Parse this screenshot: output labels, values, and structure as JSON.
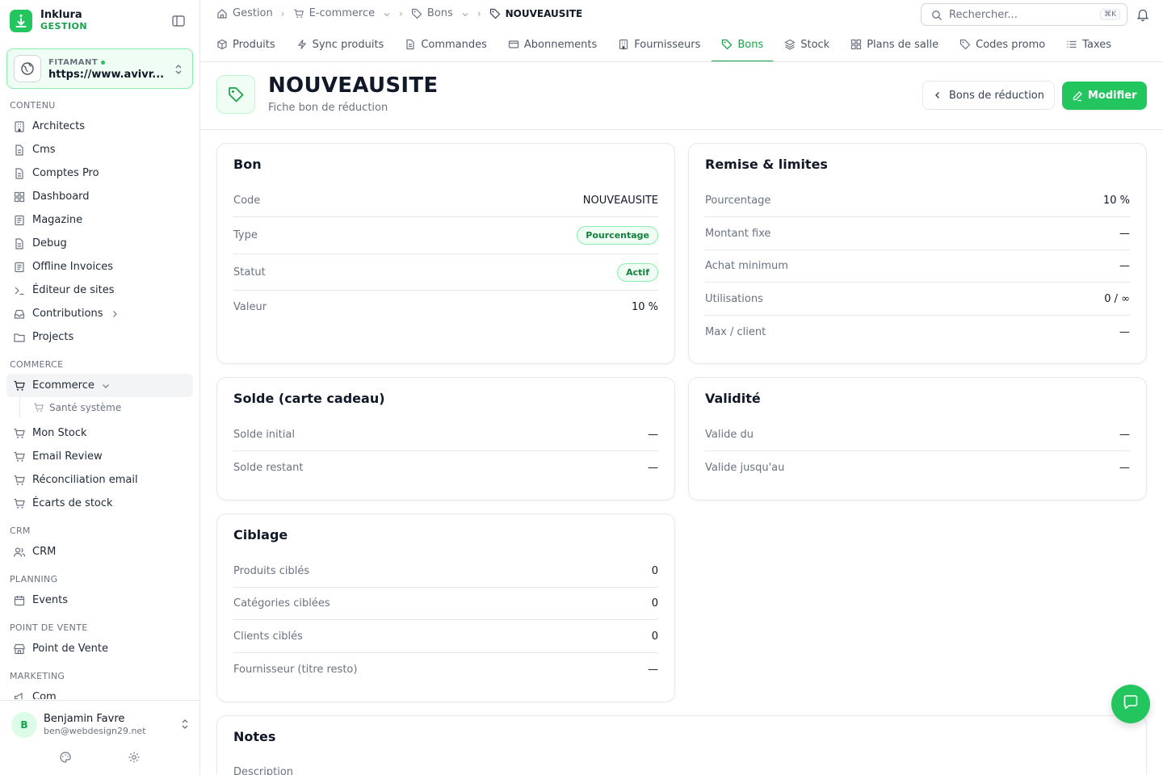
{
  "brand": {
    "name": "Inklura",
    "sub": "GESTION"
  },
  "site": {
    "label": "FITAMANT",
    "url": "https://www.avivr..."
  },
  "nav": {
    "contenu": {
      "title": "CONTENU",
      "items": [
        "Architects",
        "Cms",
        "Comptes Pro",
        "Dashboard",
        "Magazine",
        "Debug",
        "Offline Invoices",
        "Éditeur de sites",
        "Contributions",
        "Projects"
      ]
    },
    "commerce": {
      "title": "COMMERCE",
      "active": "Ecommerce",
      "sub": "Santé système",
      "items": [
        "Mon Stock",
        "Email Review",
        "Réconciliation email",
        "Écarts de stock"
      ]
    },
    "crm": {
      "title": "CRM",
      "items": [
        "CRM"
      ]
    },
    "planning": {
      "title": "PLANNING",
      "items": [
        "Events"
      ]
    },
    "pdv": {
      "title": "POINT DE VENTE",
      "items": [
        "Point de Vente"
      ]
    },
    "marketing": {
      "title": "MARKETING",
      "items": [
        "Com"
      ]
    }
  },
  "user": {
    "initial": "B",
    "name": "Benjamin Favre",
    "email": "ben@webdesign29.net"
  },
  "breadcrumb": [
    "Gestion",
    "E-commerce",
    "Bons",
    "NOUVEAUSITE"
  ],
  "search": {
    "placeholder": "Rechercher...",
    "shortcut": "⌘K"
  },
  "tabs": [
    "Produits",
    "Sync produits",
    "Commandes",
    "Abonnements",
    "Fournisseurs",
    "Bons",
    "Stock",
    "Plans de salle",
    "Codes promo",
    "Taxes"
  ],
  "active_tab": "Bons",
  "header": {
    "title": "NOUVEAUSITE",
    "subtitle": "Fiche bon de réduction",
    "back_label": "Bons de réduction",
    "edit_label": "Modifier"
  },
  "bon": {
    "title": "Bon",
    "code_label": "Code",
    "code": "NOUVEAUSITE",
    "type_label": "Type",
    "type": "Pourcentage",
    "status_label": "Statut",
    "status": "Actif",
    "value_label": "Valeur",
    "value": "10 %"
  },
  "remise": {
    "title": "Remise & limites",
    "rows": [
      {
        "label": "Pourcentage",
        "value": "10 %"
      },
      {
        "label": "Montant fixe",
        "value": "—"
      },
      {
        "label": "Achat minimum",
        "value": "—"
      },
      {
        "label": "Utilisations",
        "value": "0 / ∞"
      },
      {
        "label": "Max / client",
        "value": "—"
      }
    ]
  },
  "solde": {
    "title": "Solde (carte cadeau)",
    "rows": [
      {
        "label": "Solde initial",
        "value": "—"
      },
      {
        "label": "Solde restant",
        "value": "—"
      }
    ]
  },
  "validite": {
    "title": "Validité",
    "rows": [
      {
        "label": "Valide du",
        "value": "—"
      },
      {
        "label": "Valide jusqu'au",
        "value": "—"
      }
    ]
  },
  "ciblage": {
    "title": "Ciblage",
    "rows": [
      {
        "label": "Produits ciblés",
        "value": "0"
      },
      {
        "label": "Catégories ciblées",
        "value": "0"
      },
      {
        "label": "Clients ciblés",
        "value": "0"
      },
      {
        "label": "Fournisseur (titre resto)",
        "value": "—"
      }
    ]
  },
  "notes": {
    "title": "Notes",
    "description_label": "Description"
  },
  "colors": {
    "accent": "#22c55e",
    "accent_dark": "#16a34a",
    "accent_light": "#f0fdf4",
    "border": "#e5e7eb"
  }
}
